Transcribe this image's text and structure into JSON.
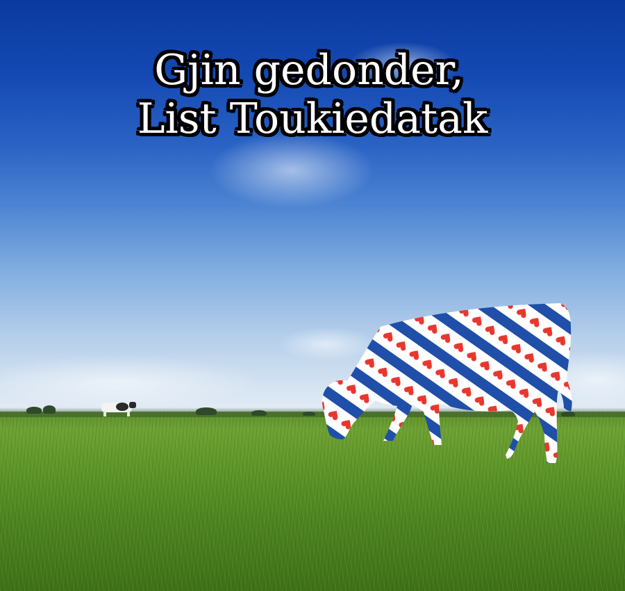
{
  "headline": {
    "line1": "Gjin gedonder,",
    "line2": "List Toukiedatak"
  },
  "colors": {
    "sky_top": "#0b3a9e",
    "sky_horizon": "#e6eef6",
    "grass": "#5d9428",
    "flag_blue": "#1f4fa8",
    "flag_red": "#e8372f",
    "flag_white": "#ffffff",
    "text": "#ffffff",
    "text_outline": "#000000"
  },
  "icons": {
    "cow_flag": "frisian-flag-cow-silhouette-icon",
    "distant_cow": "distant-cow-icon"
  }
}
